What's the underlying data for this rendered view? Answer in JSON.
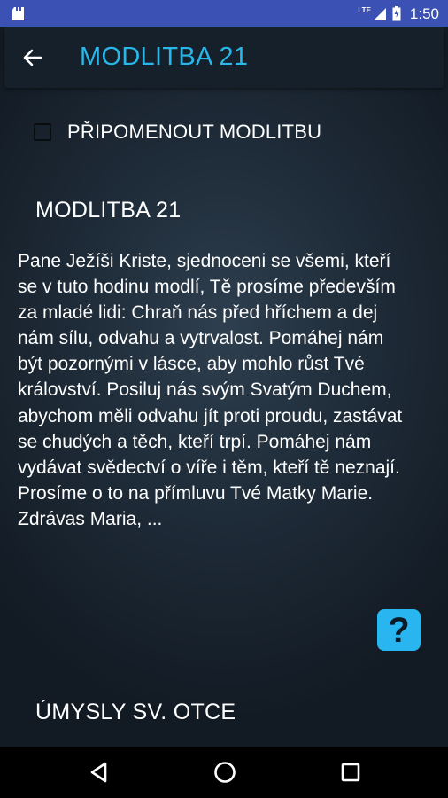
{
  "status_bar": {
    "network_type": "LTE",
    "time": "1:50",
    "icons": [
      "app-notification-icon",
      "signal-icon",
      "battery-icon"
    ]
  },
  "toolbar": {
    "back_icon": "arrow-left-icon",
    "title": "MODLITBA 21"
  },
  "reminder": {
    "checked": false,
    "label": "PŘIPOMENOUT MODLITBU"
  },
  "prayer": {
    "title": "MODLITBA 21",
    "text": "Pane Ježíši Kriste, sjednoceni se všemi, kteří se v tuto hodinu modlí, Tě prosíme především za mladé lidi: Chraň nás před hříchem a dej nám sílu, odvahu a vytrvalost. Pomáhej nám být pozornými v lásce, aby mohlo růst Tvé království. Posiluj nás svým Svatým Duchem, abychom měli odvahu jít proti proudu, zastávat se chudých a těch, kteří trpí. Pomáhej nám vydávat svědectví o víře i těm, kteří tě neznají. Prosíme o to na přímluvu Tvé Matky Marie. Zdrávas Maria, ..."
  },
  "help_button": {
    "label": "?",
    "color": "#29b6f0"
  },
  "section": {
    "title": "ÚMYSLY SV. OTCE"
  },
  "nav_bar": {
    "icons": [
      "back-triangle-icon",
      "home-circle-icon",
      "recents-square-icon"
    ]
  },
  "colors": {
    "accent": "#29b6e8",
    "status_bar": "#3b52b4",
    "toolbar": "#15202a"
  }
}
